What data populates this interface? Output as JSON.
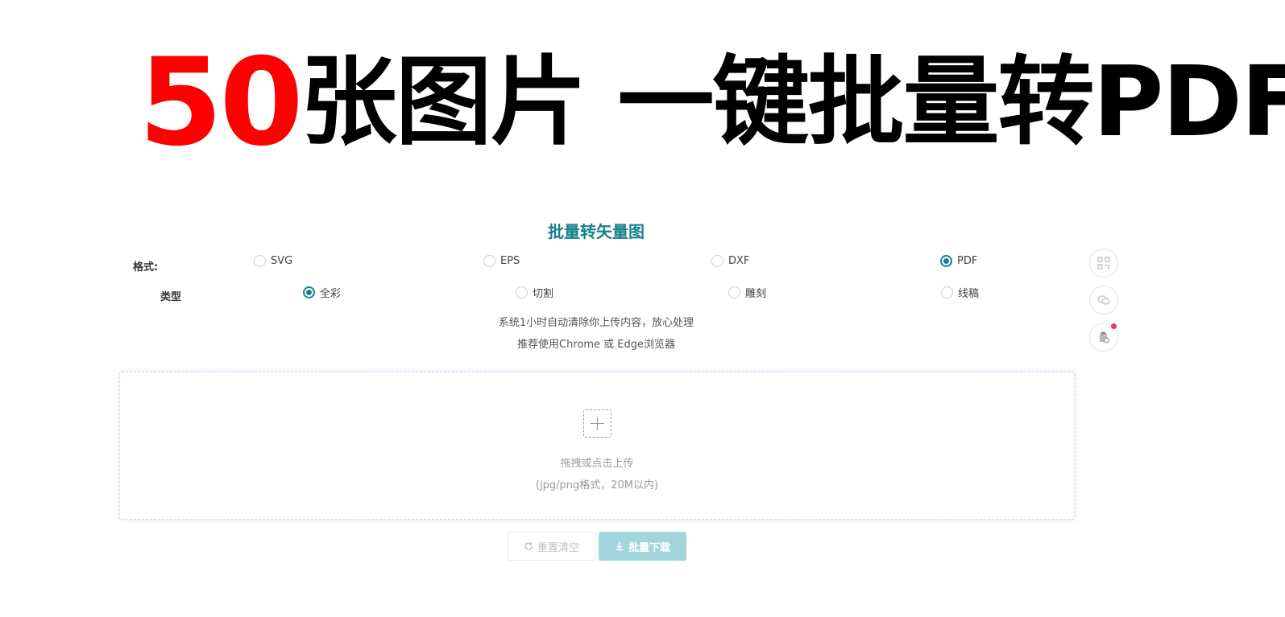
{
  "banner": {
    "number": "50",
    "text": "张图片 一键批量转PDF"
  },
  "tool": {
    "title": "批量转矢量图",
    "format": {
      "label": "格式:",
      "options": [
        "SVG",
        "EPS",
        "DXF",
        "PDF"
      ],
      "selected": "PDF"
    },
    "type": {
      "label": "类型",
      "options": [
        "全彩",
        "切割",
        "雕刻",
        "线稿"
      ],
      "selected": "全彩"
    },
    "notes": [
      "系统1小时自动清除你上传内容，放心处理",
      "推荐使用Chrome 或 Edge浏览器"
    ]
  },
  "upload": {
    "main_text": "拖拽或点击上传",
    "sub_text": "(jpg/png格式，20M以内)"
  },
  "actions": {
    "reset_label": "重置清空",
    "download_label": "批量下载"
  },
  "side_buttons": [
    "qrcode-icon",
    "wechat-icon",
    "clipboard-icon"
  ],
  "colors": {
    "accent": "#16808f",
    "banner_number": "#ff0000",
    "download_bg": "#a3d6dc",
    "badge": "#e8384f"
  }
}
